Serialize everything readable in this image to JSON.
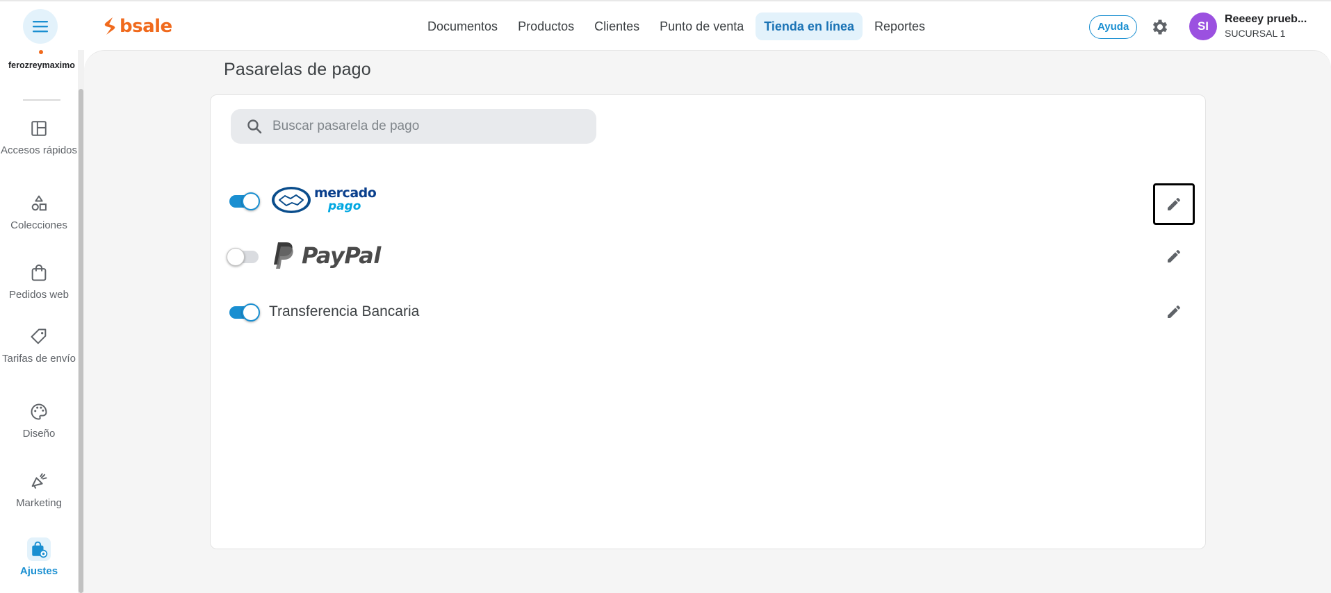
{
  "header": {
    "brand": "bsale",
    "nav": [
      {
        "label": "Documentos",
        "active": false
      },
      {
        "label": "Productos",
        "active": false
      },
      {
        "label": "Clientes",
        "active": false
      },
      {
        "label": "Punto de venta",
        "active": false
      },
      {
        "label": "Tienda en línea",
        "active": true
      },
      {
        "label": "Reportes",
        "active": false
      }
    ],
    "help_label": "Ayuda",
    "avatar_initials": "SI",
    "user_name": "Reeeey prueb...",
    "user_branch": "SUCURSAL 1"
  },
  "sidebar": {
    "store_name": "ferozreymaximo",
    "items": [
      {
        "label": "Accesos rápidos",
        "icon": "dashboard-icon",
        "active": false
      },
      {
        "label": "Colecciones",
        "icon": "shapes-icon",
        "active": false
      },
      {
        "label": "Pedidos web",
        "icon": "shopping-bag-icon",
        "active": false
      },
      {
        "label": "Tarifas de envío",
        "icon": "tag-icon",
        "active": false
      },
      {
        "label": "Diseño",
        "icon": "palette-icon",
        "active": false
      },
      {
        "label": "Marketing",
        "icon": "megaphone-icon",
        "active": false
      },
      {
        "label": "Ajustes",
        "icon": "settings-bag-icon",
        "active": true
      }
    ]
  },
  "main": {
    "title": "Pasarelas de pago",
    "search_placeholder": "Buscar pasarela de pago",
    "search_value": "",
    "gateways": [
      {
        "name": "Mercado Pago",
        "logo_text_1": "mercado",
        "logo_text_2": "pago",
        "enabled": true
      },
      {
        "name": "PayPal",
        "logo_text": "PayPal",
        "enabled": false
      },
      {
        "name": "Transferencia Bancaria",
        "enabled": true
      }
    ]
  },
  "colors": {
    "accent": "#1a8fd1",
    "brand": "#f06a1d",
    "avatar": "#9b51e0"
  }
}
